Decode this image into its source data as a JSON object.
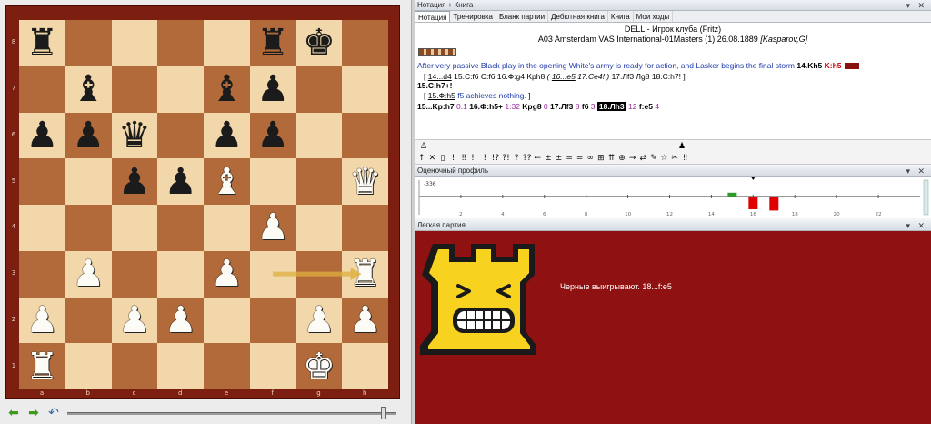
{
  "board": {
    "rank_labels": [
      "8",
      "7",
      "6",
      "5",
      "4",
      "3",
      "2",
      "1"
    ],
    "file_labels": [
      "a",
      "b",
      "c",
      "d",
      "e",
      "f",
      "g",
      "h"
    ],
    "squares": [
      [
        "bR",
        "",
        "",
        "",
        "",
        "bR",
        "bK",
        ""
      ],
      [
        "",
        "bB",
        "",
        "",
        "bB",
        "bP",
        "",
        ""
      ],
      [
        "bP",
        "bP",
        "bQ",
        "",
        "bP",
        "bP",
        "",
        ""
      ],
      [
        "",
        "",
        "bP",
        "bP",
        "wB",
        "",
        "",
        "wQ"
      ],
      [
        "",
        "",
        "",
        "",
        "",
        "wP",
        "",
        ""
      ],
      [
        "",
        "wP",
        "",
        "",
        "wP",
        "",
        "",
        "wR"
      ],
      [
        "wP",
        "",
        "wP",
        "wP",
        "",
        "",
        "wP",
        "wP"
      ],
      [
        "wR",
        "",
        "",
        "",
        "",
        "",
        "wK",
        ""
      ]
    ],
    "last_move": {
      "from": "f3",
      "to": "h3"
    },
    "colors": {
      "light": "#f1d7a9",
      "dark": "#b26a3a",
      "frame": "#7c1f10",
      "arrow": "#e0b040"
    }
  },
  "nav": {
    "back_icon": "arrow-left-icon",
    "forward_icon": "arrow-right-icon",
    "undo_icon": "undo-icon",
    "slider_value": 0.97
  },
  "notation": {
    "window_title": "Нотация + Книга",
    "tabs": [
      "Нотация",
      "Тренировка",
      "Бланк партии",
      "Дебютная книга",
      "Книга",
      "Мои ходы"
    ],
    "white_player": "DELL - Игрок клуба (Fritz)",
    "game_info": "A03 Amsterdam VAS International-01Masters (1) 26.08.1889",
    "game_info_italic": "[Kasparov,G]",
    "comment": "After very passive Black play in the opening White's army is ready for action, and Lasker begins the final storm",
    "comment_move": "14.Kh5",
    "comment_eval": "K:h5",
    "var1": {
      "open": "[",
      "m1": "14...d4",
      "m2": "15.С:f6",
      "m3": "С:f6",
      "m4": "16.Ф:g4",
      "m5": "Kph8",
      "sub_open": "(",
      "m6": "16...e5",
      "m7": "17.Ce4!",
      "sub_close": ")",
      "m8": "17.Лf3",
      "m9": "Лg8",
      "m10": "18.С:h7!",
      "close": "]"
    },
    "main2": "15.С:h7+!",
    "var2": {
      "open": "[",
      "m1": "15.Ф:h5",
      "text": "f5 achieves nothing.",
      "close": "]"
    },
    "main3": {
      "m1": "15...Kp:h7",
      "s1": "0.1",
      "m2": "16.Ф:h5+",
      "s2": "1:32",
      "m3": "Kpg8",
      "s3": "0",
      "m4": "17.Лf3",
      "s4": "8",
      "m5": "f6",
      "s5": "3",
      "cur": "18.Лh3",
      "s6": "12",
      "m6": "f:e5",
      "s7": "4"
    }
  },
  "symbols": {
    "row2": [
      "↑",
      "✕",
      "▯",
      "!",
      "‼",
      "!!",
      "!",
      "!?",
      "?!",
      "?",
      "??",
      "←",
      "±",
      "±",
      "=",
      "=",
      "∞",
      "⊞",
      "⇈",
      "⊕",
      "→",
      "⇄",
      "✎",
      "☆",
      "✂",
      "‼"
    ]
  },
  "profile": {
    "window_title": "Оценочный профиль",
    "value_label": "-336",
    "x_ticks": [
      "2",
      "4",
      "6",
      "8",
      "10",
      "12",
      "14",
      "16",
      "18",
      "20",
      "22"
    ],
    "bars": [
      {
        "move": 15,
        "value": 0.3,
        "color": "#2e9a2e"
      },
      {
        "move": 16,
        "value": -1.0,
        "color": "#e00000"
      },
      {
        "move": 17,
        "value": -1.1,
        "color": "#e00000"
      }
    ],
    "colors": {
      "positive": "#2e9a2e",
      "negative": "#e00000"
    }
  },
  "light": {
    "window_title": "Легкая партия",
    "verdict": "Черные выигрывают.  18...f:e5",
    "mascot_icon": "grinning-rook-icon",
    "colors": {
      "background": "#8f1111",
      "mascot": "#f7d21e"
    }
  }
}
